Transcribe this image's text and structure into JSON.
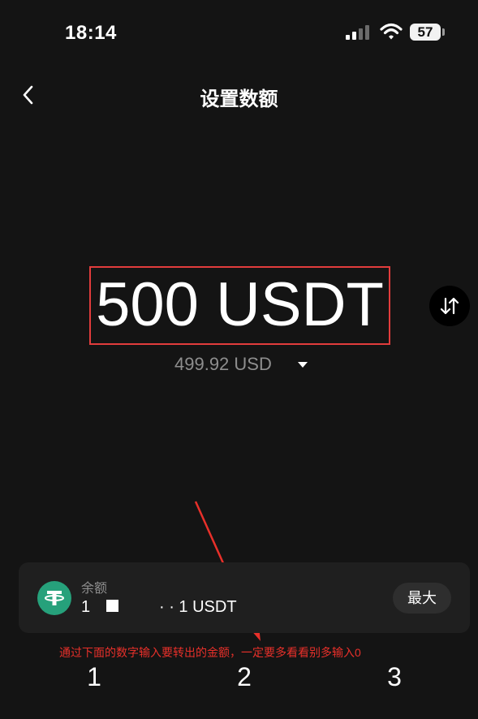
{
  "status_bar": {
    "time": "18:14",
    "battery": "57"
  },
  "nav": {
    "title": "设置数额",
    "back_icon": "chevron-left-icon"
  },
  "amount": {
    "value": "500 USDT",
    "fiat_value": "499.92 USD",
    "swap_icon": "swap-vertical-icon"
  },
  "balance": {
    "label": "余额",
    "value_part1": "1",
    "value_part2": "· · 1 USDT",
    "token_icon": "tether-icon",
    "max_label": "最大"
  },
  "annotation": {
    "text": "通过下面的数字输入要转出的金额，一定要多看看别多输入0",
    "color": "#e8302a"
  },
  "keypad": {
    "keys": [
      "1",
      "2",
      "3"
    ]
  },
  "colors": {
    "background": "#141414",
    "card": "#1f1f1f",
    "token": "#26a17b",
    "highlight_box": "#e23c3c"
  }
}
